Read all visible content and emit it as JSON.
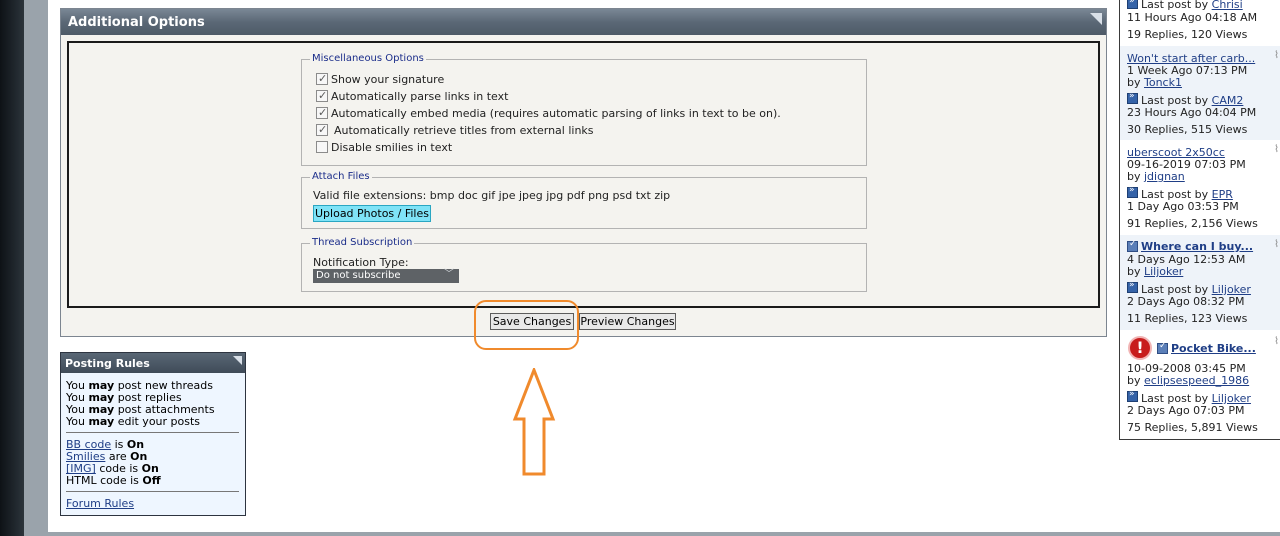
{
  "additional_options": {
    "title": "Additional Options",
    "misc": {
      "legend": "Miscellaneous Options",
      "options": [
        {
          "label": "Show your signature",
          "checked": true
        },
        {
          "label": "Automatically parse links in text",
          "checked": true
        },
        {
          "label": "Automatically embed media (requires automatic parsing of links in text to be on).",
          "checked": true
        },
        {
          "label": "Automatically retrieve titles from external links",
          "checked": true
        },
        {
          "label": "Disable smilies in text",
          "checked": false
        }
      ]
    },
    "attach": {
      "legend": "Attach Files",
      "extensions": "Valid file extensions: bmp doc gif jpe jpeg jpg pdf png psd txt zip",
      "upload_label": "Upload Photos / Files"
    },
    "thread": {
      "legend": "Thread Subscription",
      "notification_label": "Notification Type:",
      "notification_value": "Do not subscribe"
    },
    "save_label": "Save Changes",
    "preview_label": "Preview Changes"
  },
  "annotation": {
    "color": "#f08a2c"
  },
  "posting_rules": {
    "title": "Posting Rules",
    "you": "You",
    "may": "may",
    "items": [
      "post new threads",
      "post replies",
      "post attachments",
      "edit your posts"
    ],
    "bbcode_link": "BB code",
    "bbcode_mid": "is",
    "bbcode_state": "On",
    "smilies_link": "Smilies",
    "smilies_mid": "are",
    "smilies_state": "On",
    "img_link": "[IMG]",
    "img_mid": "code is",
    "img_state": "On",
    "html_text": "HTML code is",
    "html_state": "Off",
    "forum_rules": "Forum Rules"
  },
  "sidebar": {
    "last_post_by": "Last post by",
    "by": "by",
    "t1": {
      "last_poster": "Chrisi",
      "last_time": "11 Hours Ago 04:18 AM",
      "stats": "19 Replies, 120 Views"
    },
    "t2": {
      "title": "Won't start after carb...",
      "date": "1 Week Ago 07:13 PM",
      "author": "Tonck1",
      "last_poster": "CAM2",
      "last_time": "23 Hours Ago 04:04 PM",
      "stats": "30 Replies, 515 Views"
    },
    "t3": {
      "title": "uberscoot 2x50cc",
      "date": "09-16-2019 07:03 PM",
      "author": "jdignan",
      "last_poster": "EPR",
      "last_time": "1 Day Ago 03:53 PM",
      "stats": "91 Replies, 2,156 Views"
    },
    "t4": {
      "title": "Where can I buy...",
      "date": "4 Days Ago 12:53 AM",
      "author": "Liljoker",
      "last_poster": "Liljoker",
      "last_time": "2 Days Ago 08:32 PM",
      "stats": "11 Replies, 123 Views"
    },
    "t5": {
      "title": "Pocket Bike...",
      "date": "10-09-2008 03:45 PM",
      "author": "eclipsespeed_1986",
      "last_poster": "Liljoker",
      "last_time": "2 Days Ago 07:03 PM",
      "stats": "75 Replies, 5,891 Views"
    }
  }
}
